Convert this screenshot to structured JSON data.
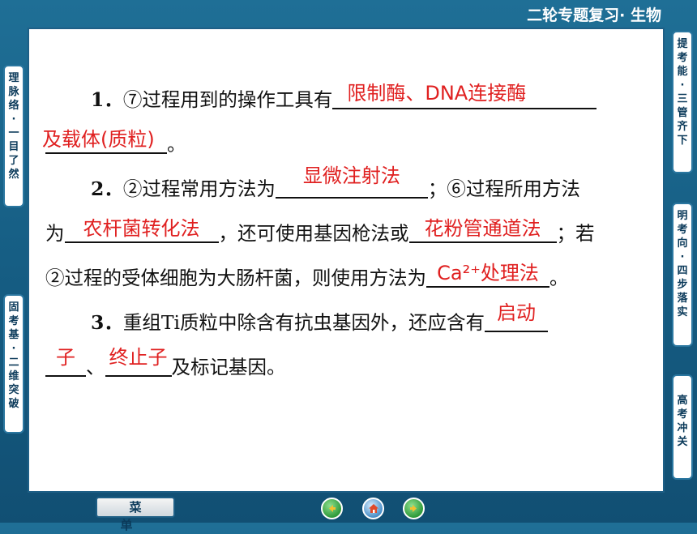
{
  "header": {
    "title": "二轮专题复习· 生物"
  },
  "left_tabs": [
    {
      "label": "理脉络·一目了然",
      "chars": [
        "理",
        "脉",
        "络",
        "·",
        "一",
        "目",
        "了",
        "然"
      ]
    },
    {
      "label": "固考基·二维突破",
      "chars": [
        "固",
        "考",
        "基",
        "·",
        "二",
        "维",
        "突",
        "破"
      ]
    }
  ],
  "right_tabs": [
    {
      "label": "提考能·三管齐下",
      "chars": [
        "提",
        "考",
        "能",
        "·",
        "三",
        "管",
        "齐",
        "下"
      ]
    },
    {
      "label": "明考向·四步落实",
      "chars": [
        "明",
        "考",
        "向",
        "·",
        "四",
        "步",
        "落",
        "实"
      ]
    },
    {
      "label": "高考冲关",
      "chars": [
        "高",
        "考",
        "冲",
        "关"
      ]
    }
  ],
  "questions": {
    "q1": {
      "number": "1．",
      "text_a": "⑦过程用到的操作工具有",
      "answer_a": "限制酶、DNA连接酶",
      "answer_b": "及载体(质粒)",
      "text_b": "。"
    },
    "q2": {
      "number": "2．",
      "text_a": "②过程常用方法为",
      "answer_a": "显微注射法",
      "text_b": "；⑥过程所用方法",
      "text_c": "为",
      "answer_b": "农杆菌转化法",
      "text_d": "，还可使用基因枪法或",
      "answer_c": "花粉管通道法",
      "text_e": "；若",
      "text_f": "②过程的受体细胞为大肠杆菌，则使用方法为",
      "answer_d": "Ca²⁺处理法",
      "text_g": "。"
    },
    "q3": {
      "number": "3．",
      "text_a": "重组Ti质粒中除含有抗虫基因外，还应含有",
      "answer_a_part1": "启动",
      "answer_a_part2": "子",
      "text_b": "、",
      "answer_b": "终止子",
      "text_c": "及标记基因。"
    }
  },
  "footer": {
    "menu_label": "菜单",
    "icons": [
      "back-icon",
      "home-icon",
      "forward-icon"
    ],
    "icon_colors": {
      "back": "#2f9a3a",
      "home": "#4a90c8",
      "forward": "#2f9a3a"
    }
  },
  "colors": {
    "answer": "#e02020",
    "background": "#155c82",
    "tab_text": "#0b3a5a"
  }
}
